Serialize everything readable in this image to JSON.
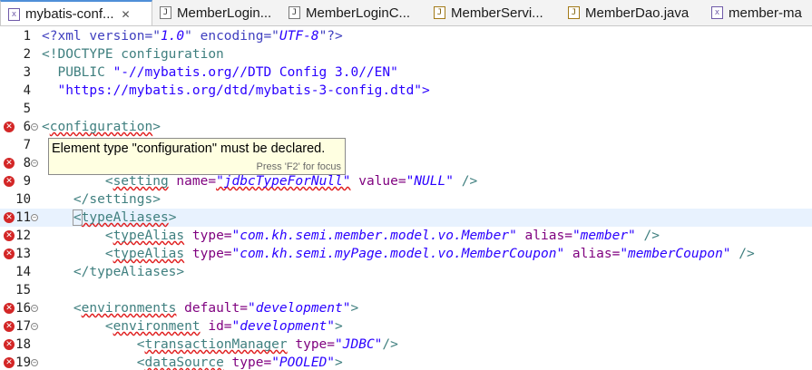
{
  "tabs": [
    {
      "label": "mybatis-conf...",
      "icon": "xml",
      "active": true,
      "close": "✕"
    },
    {
      "label": "MemberLogin...",
      "icon": "jsp"
    },
    {
      "label": "MemberLoginC...",
      "icon": "jsp"
    },
    {
      "label": "MemberServi...",
      "icon": "java"
    },
    {
      "label": "MemberDao.java",
      "icon": "java"
    },
    {
      "label": "member-ma",
      "icon": "xml"
    }
  ],
  "editor": {
    "lines": [
      {
        "n": "1",
        "segs": [
          [
            "pi",
            "<?xml version=\""
          ],
          [
            "val",
            "1.0"
          ],
          [
            "pi",
            "\" encoding=\""
          ],
          [
            "val",
            "UTF-8"
          ],
          [
            "pi",
            "\"?>"
          ]
        ]
      },
      {
        "n": "2",
        "segs": [
          [
            "tag",
            "<!DOCTYPE configuration"
          ]
        ]
      },
      {
        "n": "3",
        "segs": [
          [
            "tag",
            "  PUBLIC "
          ],
          [
            "str",
            "\"-//mybatis.org//DTD Config 3.0//EN\""
          ]
        ]
      },
      {
        "n": "4",
        "segs": [
          [
            "str",
            "  \"https://mybatis.org/dtd/mybatis-3-config.dtd\">"
          ]
        ]
      },
      {
        "n": "5",
        "segs": []
      },
      {
        "n": "6",
        "err": true,
        "fold": true,
        "segs": [
          [
            "tag",
            "<"
          ],
          [
            "tag sq",
            "configuration"
          ],
          [
            "tag",
            ">"
          ]
        ]
      },
      {
        "n": "7",
        "segs": []
      },
      {
        "n": "8",
        "err": true,
        "fold": true,
        "segs": []
      },
      {
        "n": "9",
        "err": true,
        "segs": [
          [
            "tag",
            "        <"
          ],
          [
            "tag sq",
            "setting"
          ],
          [
            "attr",
            " name="
          ],
          [
            "val sq",
            "\"jdbcTypeForNull\""
          ],
          [
            "attr",
            " value="
          ],
          [
            "val",
            "\"NULL\""
          ],
          [
            "tag",
            " />"
          ]
        ]
      },
      {
        "n": "10",
        "segs": [
          [
            "tag",
            "    </settings>"
          ]
        ]
      },
      {
        "n": "11",
        "err": true,
        "fold": true,
        "current": true,
        "segs": [
          [
            "tag",
            "    "
          ],
          [
            "tag boxed",
            "<"
          ],
          [
            "tag sq",
            "typeAliases"
          ],
          [
            "tag",
            ">"
          ]
        ]
      },
      {
        "n": "12",
        "err": true,
        "segs": [
          [
            "tag",
            "        <"
          ],
          [
            "tag sq",
            "typeAlias"
          ],
          [
            "attr",
            " type="
          ],
          [
            "val",
            "\"com.kh.semi.member.model.vo.Member\""
          ],
          [
            "attr",
            " alias="
          ],
          [
            "val",
            "\"member\""
          ],
          [
            "tag",
            " />"
          ]
        ]
      },
      {
        "n": "13",
        "err": true,
        "segs": [
          [
            "tag",
            "        <"
          ],
          [
            "tag sq",
            "typeAlias"
          ],
          [
            "attr",
            " type="
          ],
          [
            "val",
            "\"com.kh.semi.myPage.model.vo.MemberCoupon\""
          ],
          [
            "attr",
            " alias="
          ],
          [
            "val",
            "\"memberCoupon\""
          ],
          [
            "tag",
            " />"
          ]
        ]
      },
      {
        "n": "14",
        "segs": [
          [
            "tag",
            "    </typeAliases>"
          ]
        ]
      },
      {
        "n": "15",
        "segs": []
      },
      {
        "n": "16",
        "err": true,
        "fold": true,
        "segs": [
          [
            "tag",
            "    <"
          ],
          [
            "tag sq",
            "environments"
          ],
          [
            "attr",
            " default="
          ],
          [
            "val",
            "\"development\""
          ],
          [
            "tag",
            ">"
          ]
        ]
      },
      {
        "n": "17",
        "err": true,
        "fold": true,
        "segs": [
          [
            "tag",
            "        <"
          ],
          [
            "tag sq",
            "environment"
          ],
          [
            "attr",
            " id="
          ],
          [
            "val",
            "\"development\""
          ],
          [
            "tag",
            ">"
          ]
        ]
      },
      {
        "n": "18",
        "err": true,
        "segs": [
          [
            "tag",
            "            <"
          ],
          [
            "tag sq",
            "transactionManager"
          ],
          [
            "attr",
            " type="
          ],
          [
            "val",
            "\"JDBC\""
          ],
          [
            "tag",
            "/>"
          ]
        ]
      },
      {
        "n": "19",
        "err": true,
        "fold": true,
        "segs": [
          [
            "tag",
            "            <"
          ],
          [
            "tag sq",
            "dataSource"
          ],
          [
            "attr",
            " type="
          ],
          [
            "val",
            "\"POOLED\""
          ],
          [
            "tag",
            ">"
          ]
        ]
      }
    ]
  },
  "tooltip": {
    "message": "Element type \"configuration\" must be declared.",
    "hint": "Press 'F2' for focus"
  },
  "icons": {
    "error": "error-marker-icon",
    "fold": "fold-collapse-icon"
  },
  "colors": {
    "tag": "#3f7f7f",
    "attr": "#7f007f",
    "value": "#2a00ff",
    "error": "#d32626",
    "current_line": "#e8f2fe",
    "tooltip_bg": "#ffffe1"
  }
}
